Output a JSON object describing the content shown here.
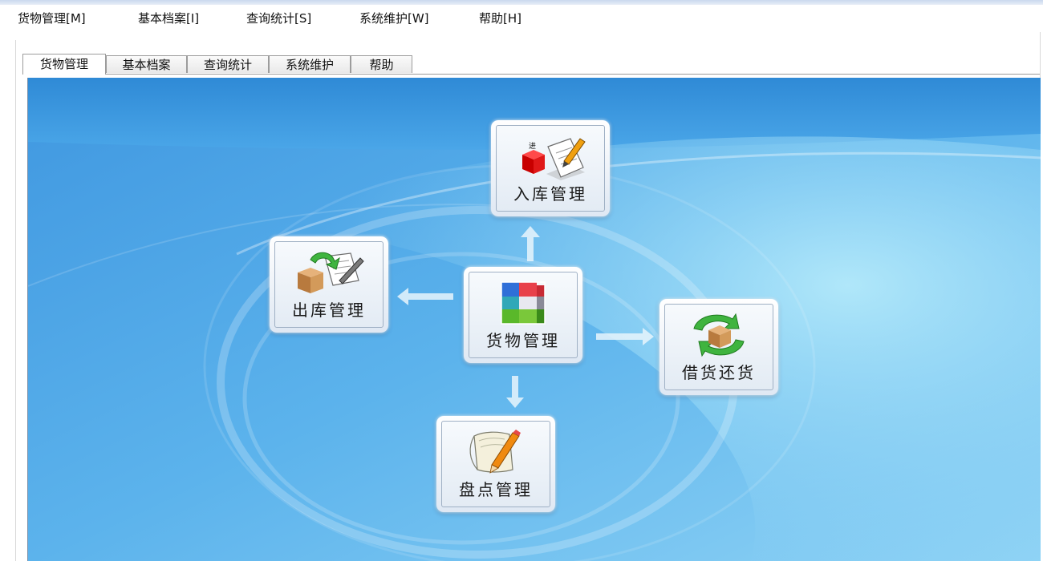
{
  "menubar": {
    "items": [
      {
        "label": "货物管理[M]"
      },
      {
        "label": "基本档案[I]"
      },
      {
        "label": "查询统计[S]"
      },
      {
        "label": "系统维护[W]"
      },
      {
        "label": "帮助[H]"
      }
    ]
  },
  "tabs": [
    {
      "label": "货物管理",
      "active": true
    },
    {
      "label": "基本档案",
      "active": false
    },
    {
      "label": "查询统计",
      "active": false
    },
    {
      "label": "系统维护",
      "active": false
    },
    {
      "label": "帮助",
      "active": false
    }
  ],
  "modules": {
    "stock_in": {
      "label": "入库管理",
      "icon": "stock-in-icon",
      "badge": "进"
    },
    "stock_out": {
      "label": "出库管理",
      "icon": "stock-out-icon"
    },
    "goods": {
      "label": "货物管理",
      "icon": "goods-cubes-icon"
    },
    "borrow_return": {
      "label": "借货还货",
      "icon": "borrow-return-icon"
    },
    "inventory": {
      "label": "盘点管理",
      "icon": "inventory-check-icon"
    }
  },
  "colors": {
    "panel_bg": "#4aa3e6",
    "arrow": "#e8f4fc"
  }
}
